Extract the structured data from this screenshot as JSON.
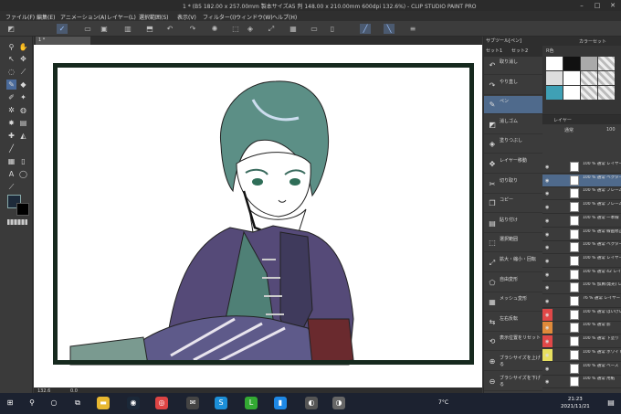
{
  "window": {
    "title": "1 * (B5 182.00 x 257.00mm 製本サイズA5 判 148.00 x 210.00mm 600dpi 132.6%) - CLIP STUDIO PAINT PRO",
    "min": "–",
    "max": "□",
    "close": "✕"
  },
  "menu": [
    "ファイル(F)",
    "編集(E)",
    "アニメーション(A)",
    "レイヤー(L)",
    "選択範囲(S)",
    "表示(V)",
    "フィルター(I)",
    "ウィンドウ(W)",
    "ヘルプ(H)"
  ],
  "document_tab": "1 *",
  "status": {
    "zoom": "132.6",
    "angle": "0.0"
  },
  "subtool": {
    "tabs": [
      "サブツール[ペン]",
      "セット1",
      "セット2"
    ],
    "items": [
      {
        "icon": "undo-icon",
        "glyph": "↶",
        "label": "取り消し"
      },
      {
        "icon": "redo-icon",
        "glyph": "↷",
        "label": "やり直し"
      },
      {
        "icon": "pen-icon",
        "glyph": "✎",
        "label": "ペン",
        "selected": true
      },
      {
        "icon": "eraser-icon",
        "glyph": "◩",
        "label": "消しゴム"
      },
      {
        "icon": "fill-icon",
        "glyph": "◈",
        "label": "塗りつぶし"
      },
      {
        "icon": "move-layer-icon",
        "glyph": "✥",
        "label": "レイヤー移動"
      },
      {
        "icon": "cut-icon",
        "glyph": "✂",
        "label": "切り取り"
      },
      {
        "icon": "copy-icon",
        "glyph": "❐",
        "label": "コピー"
      },
      {
        "icon": "paste-icon",
        "glyph": "▤",
        "label": "貼り付け"
      },
      {
        "icon": "select-range-icon",
        "glyph": "⬚",
        "label": "選択範囲"
      },
      {
        "icon": "scale-icon",
        "glyph": "⤢",
        "label": "拡大・縮小・回転"
      },
      {
        "icon": "free-transform-icon",
        "glyph": "⬠",
        "label": "自由変形"
      },
      {
        "icon": "mesh-icon",
        "glyph": "▦",
        "label": "メッシュ変形"
      },
      {
        "icon": "flip-icon",
        "glyph": "⇆",
        "label": "左右反転"
      },
      {
        "icon": "reset-view-icon",
        "glyph": "⟲",
        "label": "表示位置をリセット"
      },
      {
        "icon": "brush-bigger-icon",
        "glyph": "⊕",
        "label": "ブラシサイズを上げる"
      },
      {
        "icon": "brush-smaller-icon",
        "glyph": "⊖",
        "label": "ブラシサイズを下げる"
      }
    ]
  },
  "palette": {
    "tabs": [
      "カラーセット"
    ],
    "set_name": "R色"
  },
  "layers": {
    "tab": "レイヤー",
    "blend": "通常",
    "opacity": "100",
    "rows": [
      {
        "name": "100 % 通常 レイヤー 3 2 0",
        "color": ""
      },
      {
        "name": "100 % 通常 ベクター 2",
        "color": "",
        "selected": true
      },
      {
        "name": "100 % 通常 フレーム",
        "color": ""
      },
      {
        "name": "100 % 通常 フレーム",
        "color": ""
      },
      {
        "name": "100 % 通常 一本線",
        "color": ""
      },
      {
        "name": "100 % 通常 線画修正",
        "color": ""
      },
      {
        "name": "100 % 通常 ベクター",
        "color": ""
      },
      {
        "name": "100 % 通常 レイヤー",
        "color": ""
      },
      {
        "name": "100 % 通常 42 レイヤー",
        "color": ""
      },
      {
        "name": "100 % 加算(発光) レイヤー",
        "color": ""
      },
      {
        "name": "76 % 通常 レイヤー 3 2 2 2",
        "color": ""
      },
      {
        "name": "100 % 通常 はいけい",
        "color": "#e04848"
      },
      {
        "name": "100 % 通常 影",
        "color": "#e08a3a"
      },
      {
        "name": "100 % 通常 下塗り",
        "color": "#e04848"
      },
      {
        "name": "100 % 通常 ホワイト",
        "color": "#e8e060"
      },
      {
        "name": "100 % 通常 ベース",
        "color": ""
      },
      {
        "name": "100 % 通常 用紙",
        "color": ""
      }
    ]
  },
  "taskbar": {
    "temp": "7°C",
    "time": "21:23",
    "date": "2021/11/21"
  }
}
